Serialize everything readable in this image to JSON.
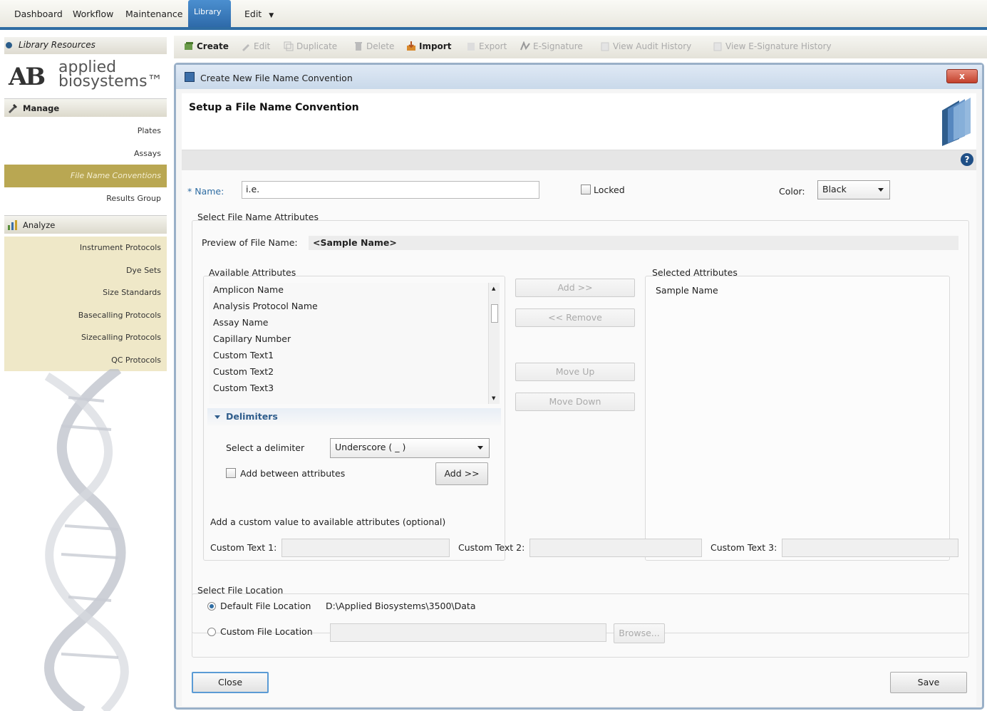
{
  "topnav": {
    "items": [
      "Dashboard",
      "Workflow",
      "Maintenance"
    ],
    "active": "Library",
    "edit": "Edit"
  },
  "sidebar": {
    "header": "Library Resources",
    "logo": {
      "mark": "AB",
      "line1": "applied",
      "line2": "biosystems™"
    },
    "manage": {
      "title": "Manage",
      "items": [
        "Plates",
        "Assays",
        "File Name Conventions",
        "Results Group"
      ]
    },
    "analyze": {
      "title": "Analyze",
      "items": [
        "Instrument Protocols",
        "Dye Sets",
        "Size Standards",
        "Basecalling Protocols",
        "Sizecalling Protocols",
        "QC Protocols"
      ]
    }
  },
  "toolbar": {
    "create": "Create",
    "edit": "Edit",
    "duplicate": "Duplicate",
    "delete": "Delete",
    "import": "Import",
    "export": "Export",
    "esignature": "E-Signature",
    "audit": "View Audit History",
    "esig_history": "View E-Signature History"
  },
  "dialog": {
    "title": "Create New File Name Convention",
    "heading": "Setup a File Name Convention",
    "close_glyph": "x",
    "help_glyph": "?",
    "name_label": "Name:",
    "name_value": "i.e.",
    "locked_label": "Locked",
    "color_label": "Color:",
    "color_value": "Black",
    "attributes_group": "Select File Name Attributes",
    "preview_label": "Preview of File Name:",
    "preview_value": "<Sample Name>",
    "available_label": "Available Attributes",
    "available_items": [
      "Amplicon Name",
      "Analysis Protocol Name",
      "Assay Name",
      "Capillary Number",
      "Custom Text1",
      "Custom Text2",
      "Custom Text3"
    ],
    "selected_label": "Selected Attributes",
    "selected_items": [
      "Sample Name"
    ],
    "add_btn": "Add >>",
    "remove_btn": "<< Remove",
    "moveup_btn": "Move Up",
    "movedown_btn": "Move Down",
    "delimiters_label": "Delimiters",
    "delimiter_select_label": "Select a delimiter",
    "delimiter_value": "Underscore ( _ )",
    "add_between_label": "Add between attributes",
    "delim_add_btn": "Add >>",
    "custom_hint": "Add a custom value to available attributes (optional)",
    "custom1_label": "Custom Text 1:",
    "custom2_label": "Custom Text 2:",
    "custom3_label": "Custom Text 3:",
    "location_group": "Select File Location",
    "default_location_label": "Default File Location",
    "default_location_path": "D:\\Applied Biosystems\\3500\\Data",
    "custom_location_label": "Custom File Location",
    "browse_btn": "Browse...",
    "close_btn": "Close",
    "save_btn": "Save"
  },
  "colors": {
    "accent": "#2f6da3",
    "sidebar_selected": "#b9a752",
    "analyze_bg": "#efe8c8"
  }
}
